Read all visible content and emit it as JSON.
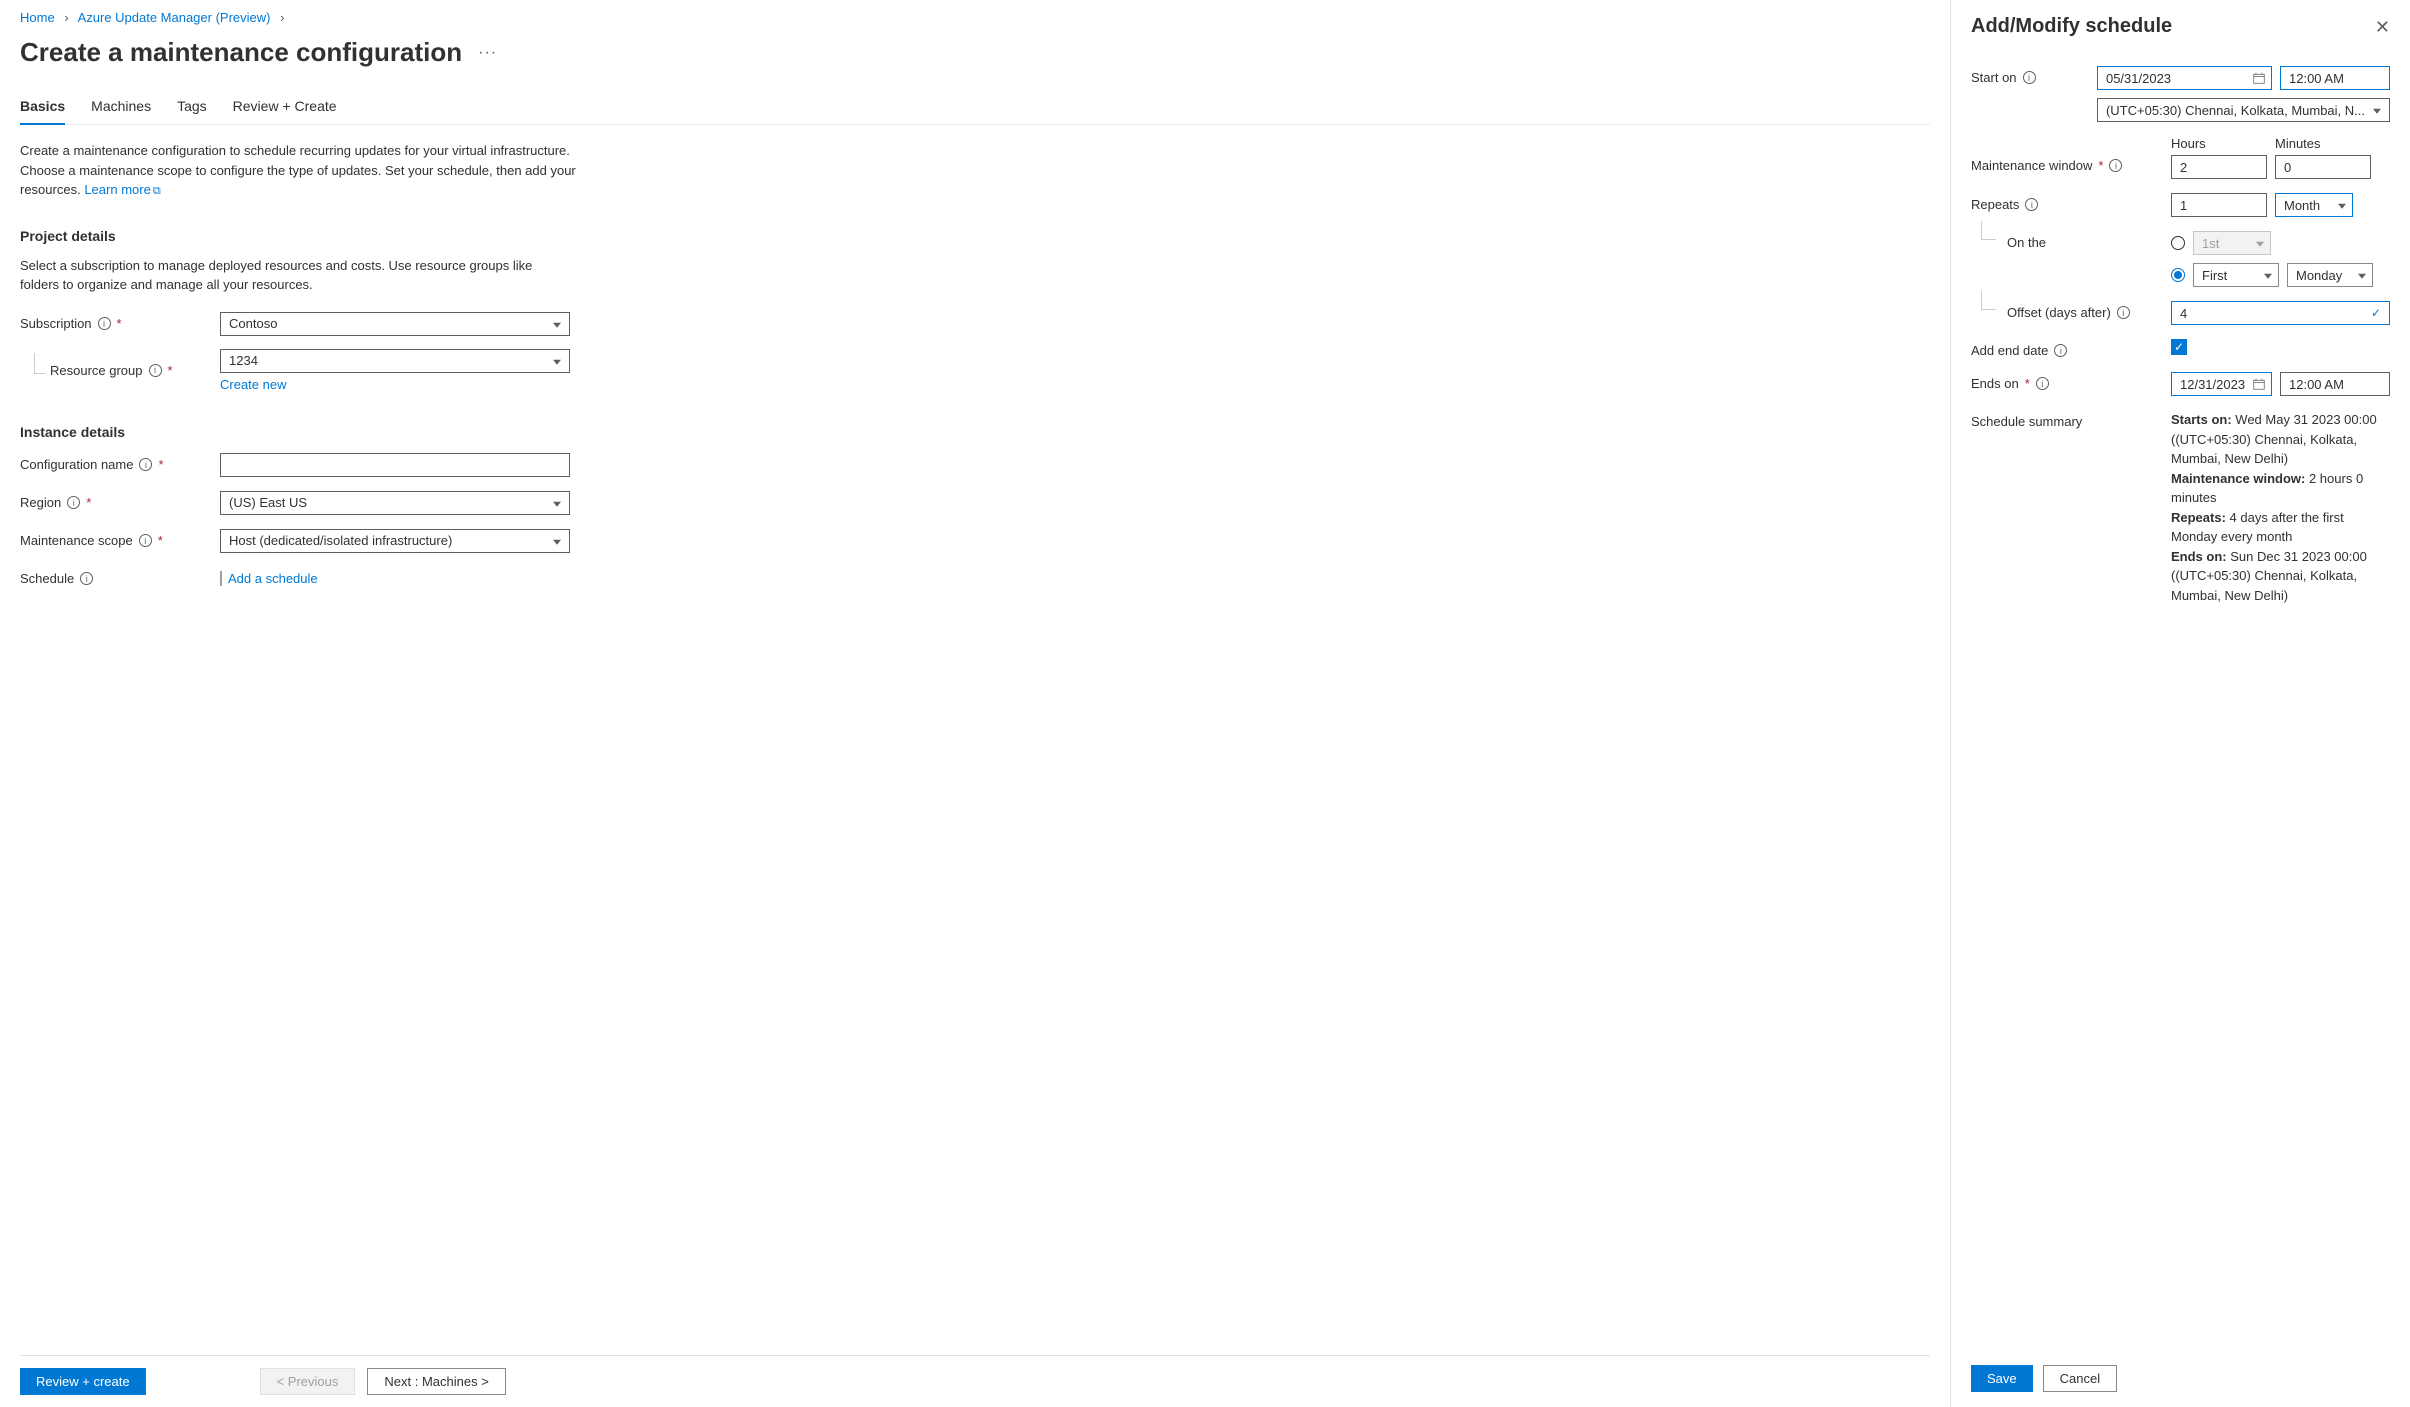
{
  "breadcrumb": {
    "home": "Home",
    "service": "Azure Update Manager (Preview)"
  },
  "page_title": "Create a maintenance configuration",
  "tabs": {
    "basics": "Basics",
    "machines": "Machines",
    "tags": "Tags",
    "review": "Review + Create"
  },
  "intro": {
    "text": "Create a maintenance configuration to schedule recurring updates for your virtual infrastructure. Choose a maintenance scope to configure the type of updates. Set your schedule, then add your resources.",
    "learn_more": "Learn more"
  },
  "project": {
    "heading": "Project details",
    "desc": "Select a subscription to manage deployed resources and costs. Use resource groups like folders to organize and manage all your resources.",
    "subscription_label": "Subscription",
    "subscription_value": "Contoso",
    "rg_label": "Resource group",
    "rg_value": "1234",
    "create_new": "Create new"
  },
  "instance": {
    "heading": "Instance details",
    "config_label": "Configuration name",
    "config_value": "",
    "region_label": "Region",
    "region_value": "(US) East US",
    "scope_label": "Maintenance scope",
    "scope_value": "Host (dedicated/isolated infrastructure)",
    "schedule_label": "Schedule",
    "add_schedule": "Add a schedule"
  },
  "footer": {
    "review": "Review + create",
    "previous": "< Previous",
    "next": "Next : Machines >"
  },
  "panel": {
    "title": "Add/Modify schedule",
    "start_on_label": "Start on",
    "start_date": "05/31/2023",
    "start_time": "12:00 AM",
    "timezone": "(UTC+05:30) Chennai, Kolkata, Mumbai, N...",
    "mw_label": "Maintenance window",
    "hours_label": "Hours",
    "hours_value": "2",
    "minutes_label": "Minutes",
    "minutes_value": "0",
    "repeats_label": "Repeats",
    "repeats_count": "1",
    "repeats_period": "Month",
    "on_the_label": "On the",
    "day_option": "1st",
    "week_ordinal": "First",
    "weekday": "Monday",
    "offset_label": "Offset (days after)",
    "offset_value": "4",
    "add_end_label": "Add end date",
    "ends_label": "Ends on",
    "ends_date": "12/31/2023",
    "ends_time": "12:00 AM",
    "summary_label": "Schedule summary",
    "summary": {
      "starts_label": "Starts on:",
      "starts_value": "Wed May 31 2023 00:00 ((UTC+05:30) Chennai, Kolkata, Mumbai, New Delhi)",
      "mw_label": "Maintenance window:",
      "mw_value": "2 hours 0 minutes",
      "rep_label": "Repeats:",
      "rep_value": "4 days after the first Monday every month",
      "ends_label": "Ends on:",
      "ends_value": "Sun Dec 31 2023 00:00 ((UTC+05:30) Chennai, Kolkata, Mumbai, New Delhi)"
    },
    "save": "Save",
    "cancel": "Cancel"
  }
}
